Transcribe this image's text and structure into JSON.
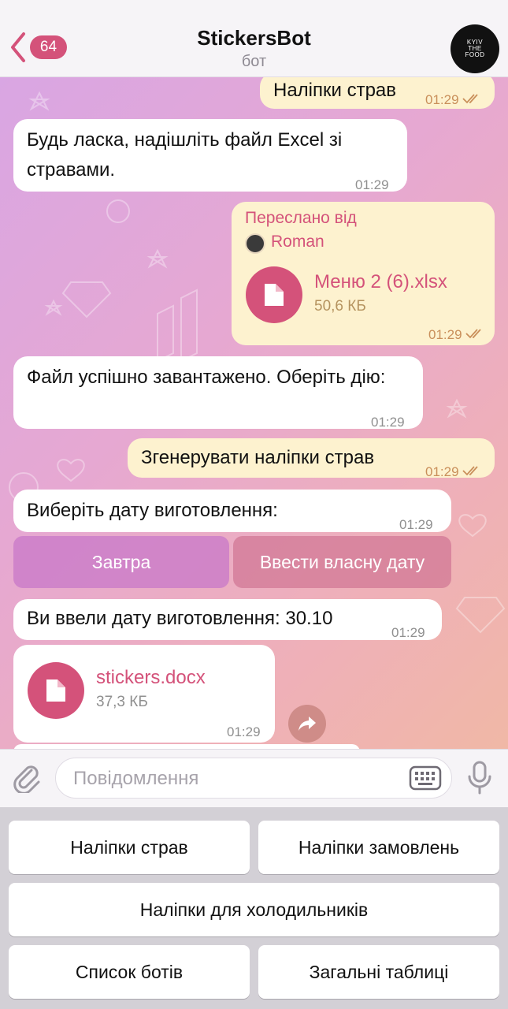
{
  "header": {
    "back_count": "64",
    "title": "StickersBot",
    "subtitle": "бот",
    "avatar_text": [
      "KYIV",
      "THE",
      "FOOD"
    ]
  },
  "messages": {
    "m1": {
      "text": "Наліпки страв",
      "time": "01:29"
    },
    "m2": {
      "text": "Будь ласка, надішліть файл Excel зі стравами.",
      "time": "01:29"
    },
    "m3": {
      "forwarded_label": "Переслано від",
      "forwarded_from": "Roman",
      "file_name": "Меню 2 (6).xlsx",
      "file_size": "50,6 КБ",
      "time": "01:29"
    },
    "m4": {
      "text": "Файл успішно завантажено. Оберіть дію:",
      "time": "01:29"
    },
    "m5": {
      "text": "Згенерувати наліпки страв",
      "time": "01:29"
    },
    "m6": {
      "text": "Виберіть дату виготовлення:",
      "time": "01:29"
    },
    "inline_buttons": [
      "Завтра",
      "Ввести власну дату"
    ],
    "m7": {
      "text": "Ви ввели дату виготовлення: 30.10",
      "time": "01:29"
    },
    "m8": {
      "file_name": "stickers.docx",
      "file_size": "37,3 КБ",
      "time": "01:29"
    }
  },
  "input": {
    "placeholder": "Повідомлення"
  },
  "keyboard": {
    "row1": [
      "Наліпки страв",
      "Наліпки замовлень"
    ],
    "row2": [
      "Наліпки для холодильників"
    ],
    "row3": [
      "Список ботів",
      "Загальні таблиці"
    ]
  },
  "colors": {
    "accent": "#d4527a",
    "outgoing_bubble": "#fdf2cf",
    "incoming_bubble": "#ffffff"
  }
}
